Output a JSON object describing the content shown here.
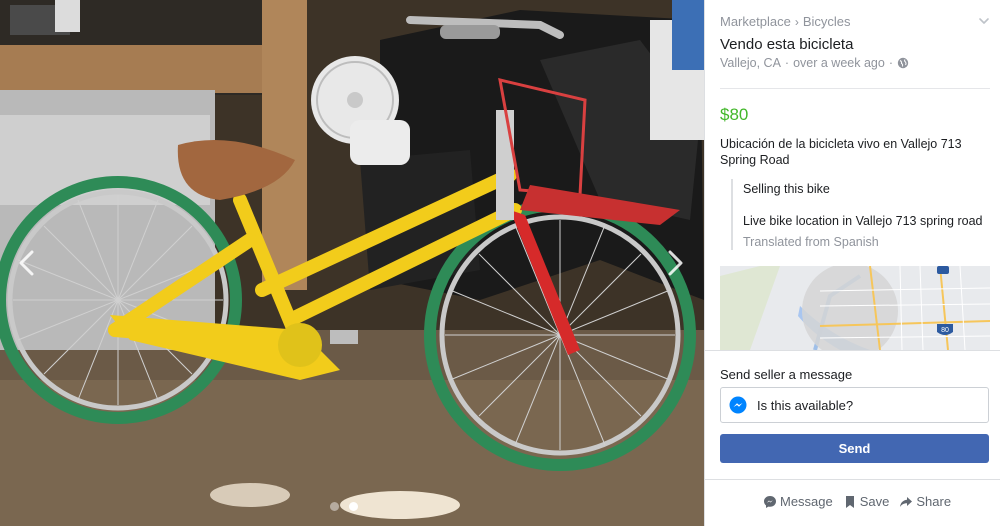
{
  "listing_photo": {
    "alt_icon": "bicycle-photo",
    "prev_icon": "chevron-left-icon",
    "next_icon": "chevron-right-icon",
    "photo_count": 2,
    "active_photo": 2
  },
  "panel": {
    "breadcrumb": {
      "root": "Marketplace",
      "separator": "›",
      "category": "Bicycles"
    },
    "collapse_icon": "chevron-down-icon",
    "title": "Vendo esta bicicleta",
    "location": "Vallejo, CA",
    "posted": "over a week ago",
    "meta_separator": "·",
    "privacy_icon": "globe-icon",
    "price": "$80",
    "description": "Ubicación de la bicicleta vivo en Vallejo 713 Spring Road",
    "translation": {
      "line1": "Selling this bike",
      "line2": "Live bike location in Vallejo 713 spring road",
      "note": "Translated from Spanish"
    },
    "map": {
      "highway_label": "80"
    }
  },
  "message": {
    "heading": "Send seller a message",
    "input_value": "Is this available?",
    "input_icon": "messenger-icon",
    "send_label": "Send"
  },
  "actions": [
    {
      "icon": "messenger-icon",
      "label": "Message"
    },
    {
      "icon": "bookmark-icon",
      "label": "Save"
    },
    {
      "icon": "share-arrow-icon",
      "label": "Share"
    }
  ],
  "colors": {
    "price": "#42b72a",
    "send_button": "#4267b2",
    "muted_text": "#90949c"
  }
}
